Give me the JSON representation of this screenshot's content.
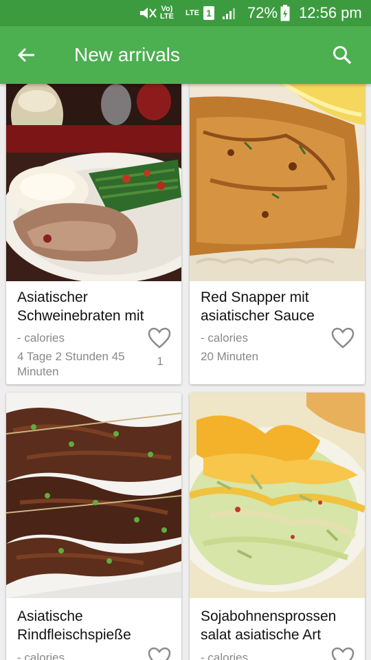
{
  "status": {
    "battery_percent": "72%",
    "time": "12:56 pm",
    "network": "LTE",
    "sim": "1"
  },
  "appbar": {
    "title": "New arrivals"
  },
  "recipes": [
    {
      "name": "Asiatischer Schweinebraten mit",
      "calories": "- calories",
      "time": "4 Tage 2 Stunden 45 Minuten",
      "likes": "1"
    },
    {
      "name": "Red Snapper mit asiatischer Sauce",
      "calories": "- calories",
      "time": "20 Minuten",
      "likes": ""
    },
    {
      "name": "Asiatische Rindfleischspieße",
      "calories": "- calories",
      "time": "",
      "likes": ""
    },
    {
      "name": "Sojabohnensprossen salat asiatische Art",
      "calories": "- calories",
      "time": "",
      "likes": ""
    }
  ],
  "colors": {
    "primary": "#4caf50",
    "status_bar": "#3d9b3f"
  }
}
